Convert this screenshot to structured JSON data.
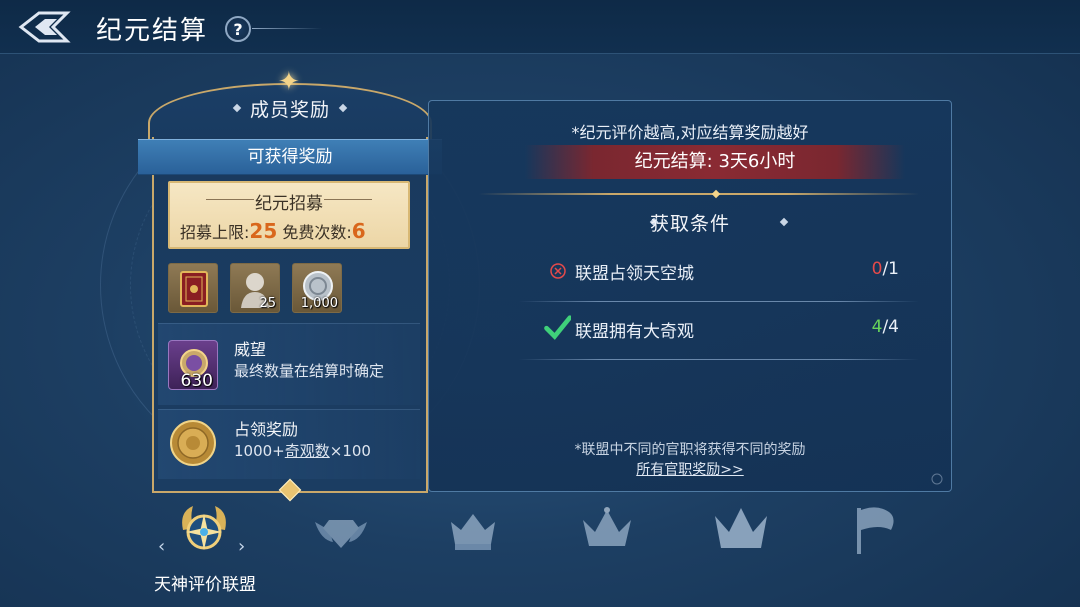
{
  "header": {
    "title": "纪元结算",
    "help_symbol": "?"
  },
  "member_rewards": {
    "title": "成员奖励",
    "ribbon": "可获得奖励",
    "recruit": {
      "title": "纪元招募",
      "limit_label": "招募上限:",
      "limit_value": "25",
      "free_label": "免费次数:",
      "free_value": "6"
    },
    "items": [
      {
        "icon": "red-book-icon",
        "qty": ""
      },
      {
        "icon": "bust-statue-icon",
        "qty": "25"
      },
      {
        "icon": "silver-coin-icon",
        "qty": "1,000"
      }
    ],
    "prestige": {
      "icon": "purple-medal-icon",
      "qty": "630",
      "title": "威望",
      "desc": "最终数量在结算时确定"
    },
    "occupation": {
      "icon": "gold-coin-icon",
      "title": "占领奖励",
      "desc_prefix": "1000+",
      "desc_link": "奇观数",
      "desc_suffix": "×100"
    }
  },
  "settlement": {
    "notice": "*纪元评价越高,对应结算奖励越好",
    "timer_label": "纪元结算:",
    "timer_value": "3天6小时",
    "conditions_title": "获取条件",
    "conditions": [
      {
        "label": "联盟占领天空城",
        "current": "0",
        "total": "/1",
        "status": "fail"
      },
      {
        "label": "联盟拥有大奇观",
        "current": "4",
        "total": "/4",
        "status": "pass"
      }
    ],
    "footnote": "*联盟中不同的官职将获得不同的奖励",
    "all_rewards_link": "所有官职奖励>>"
  },
  "tiers": {
    "selected_label": "天神评价联盟",
    "icons": [
      "compass-emblem-icon",
      "winged-diamond-icon",
      "small-crown-icon",
      "medium-crown-icon",
      "large-crown-icon",
      "flag-icon"
    ]
  },
  "colors": {
    "accent_gold": "#c9a86a",
    "fail_red": "#e54a4a",
    "pass_green": "#67d45a",
    "timer_bar": "#8a2a33"
  }
}
